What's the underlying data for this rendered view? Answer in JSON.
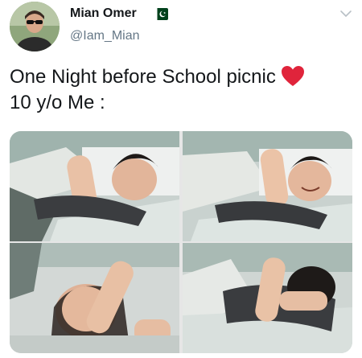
{
  "user": {
    "display_name": "Mian Omer",
    "handle": "@Iam_Mian",
    "avatar_icon": "profile-photo",
    "badge_icon": "pakistan-flag-icon"
  },
  "tweet": {
    "line1": "One Night before School picnic",
    "line1_emoji": "heart-icon",
    "line2": "10 y/o Me :"
  },
  "media": {
    "panels": 4,
    "description_icon": "photo-collage"
  },
  "colors": {
    "name": "#14171a",
    "handle": "#657786",
    "heart": "#e0243b",
    "flag_green": "#01411c"
  }
}
